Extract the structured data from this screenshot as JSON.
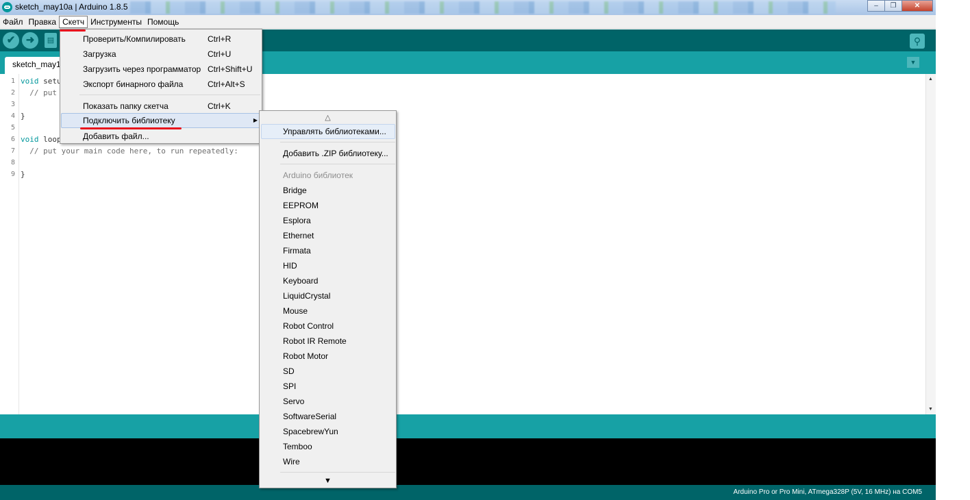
{
  "window": {
    "title": "sketch_may10a | Arduino 1.8.5",
    "controls": {
      "minimize": "‒",
      "maximize": "❐",
      "close": "✕"
    }
  },
  "menubar": {
    "items": [
      "Файл",
      "Правка",
      "Скетч",
      "Инструменты",
      "Помощь"
    ],
    "active": "Скетч"
  },
  "toolbar": {
    "verify_icon": "✔",
    "upload_icon": "➜",
    "new_icon": "▤",
    "serial_icon": "⚲"
  },
  "tabs": {
    "current": "sketch_may10a",
    "menu_icon": "▼"
  },
  "editor": {
    "lines": [
      {
        "n": "1",
        "kw": "void ",
        "rest": "setup() {"
      },
      {
        "n": "2",
        "kw": "",
        "rest": "  // put your setup code here, to run once:"
      },
      {
        "n": "3",
        "kw": "",
        "rest": ""
      },
      {
        "n": "4",
        "kw": "",
        "rest": "}"
      },
      {
        "n": "5",
        "kw": "",
        "rest": ""
      },
      {
        "n": "6",
        "kw": "void ",
        "rest": "loop() {"
      },
      {
        "n": "7",
        "kw": "",
        "rest": "  // put your main code here, to run repeatedly:"
      },
      {
        "n": "8",
        "kw": "",
        "rest": ""
      },
      {
        "n": "9",
        "kw": "",
        "rest": "}"
      }
    ]
  },
  "sketch_menu": {
    "items": [
      {
        "label": "Проверить/Компилировать",
        "shortcut": "Ctrl+R"
      },
      {
        "label": "Загрузка",
        "shortcut": "Ctrl+U"
      },
      {
        "label": "Загрузить через программатор",
        "shortcut": "Ctrl+Shift+U"
      },
      {
        "label": "Экспорт бинарного файла",
        "shortcut": "Ctrl+Alt+S"
      },
      {
        "label": "Показать папку скетча",
        "shortcut": "Ctrl+K"
      },
      {
        "label": "Подключить библиотеку",
        "shortcut": "",
        "submenu_arrow": "▶"
      },
      {
        "label": "Добавить файл...",
        "shortcut": ""
      }
    ]
  },
  "library_submenu": {
    "scroll_up": "△",
    "manage": "Управлять библиотеками...",
    "add_zip": "Добавить .ZIP библиотеку...",
    "section_header": "Arduino библиотек",
    "libraries": [
      "Bridge",
      "EEPROM",
      "Esplora",
      "Ethernet",
      "Firmata",
      "HID",
      "Keyboard",
      "LiquidCrystal",
      "Mouse",
      "Robot Control",
      "Robot IR Remote",
      "Robot Motor",
      "SD",
      "SPI",
      "Servo",
      "SoftwareSerial",
      "SpacebrewYun",
      "Temboo",
      "Wire"
    ],
    "scroll_down": "▼"
  },
  "status": {
    "board_info": "Arduino Pro or Pro Mini, ATmega328P (5V, 16 MHz) на COM5"
  },
  "colors": {
    "toolbar_dark": "#006468",
    "tabs_teal": "#17a1a5",
    "annotation_red": "#e8141e"
  }
}
